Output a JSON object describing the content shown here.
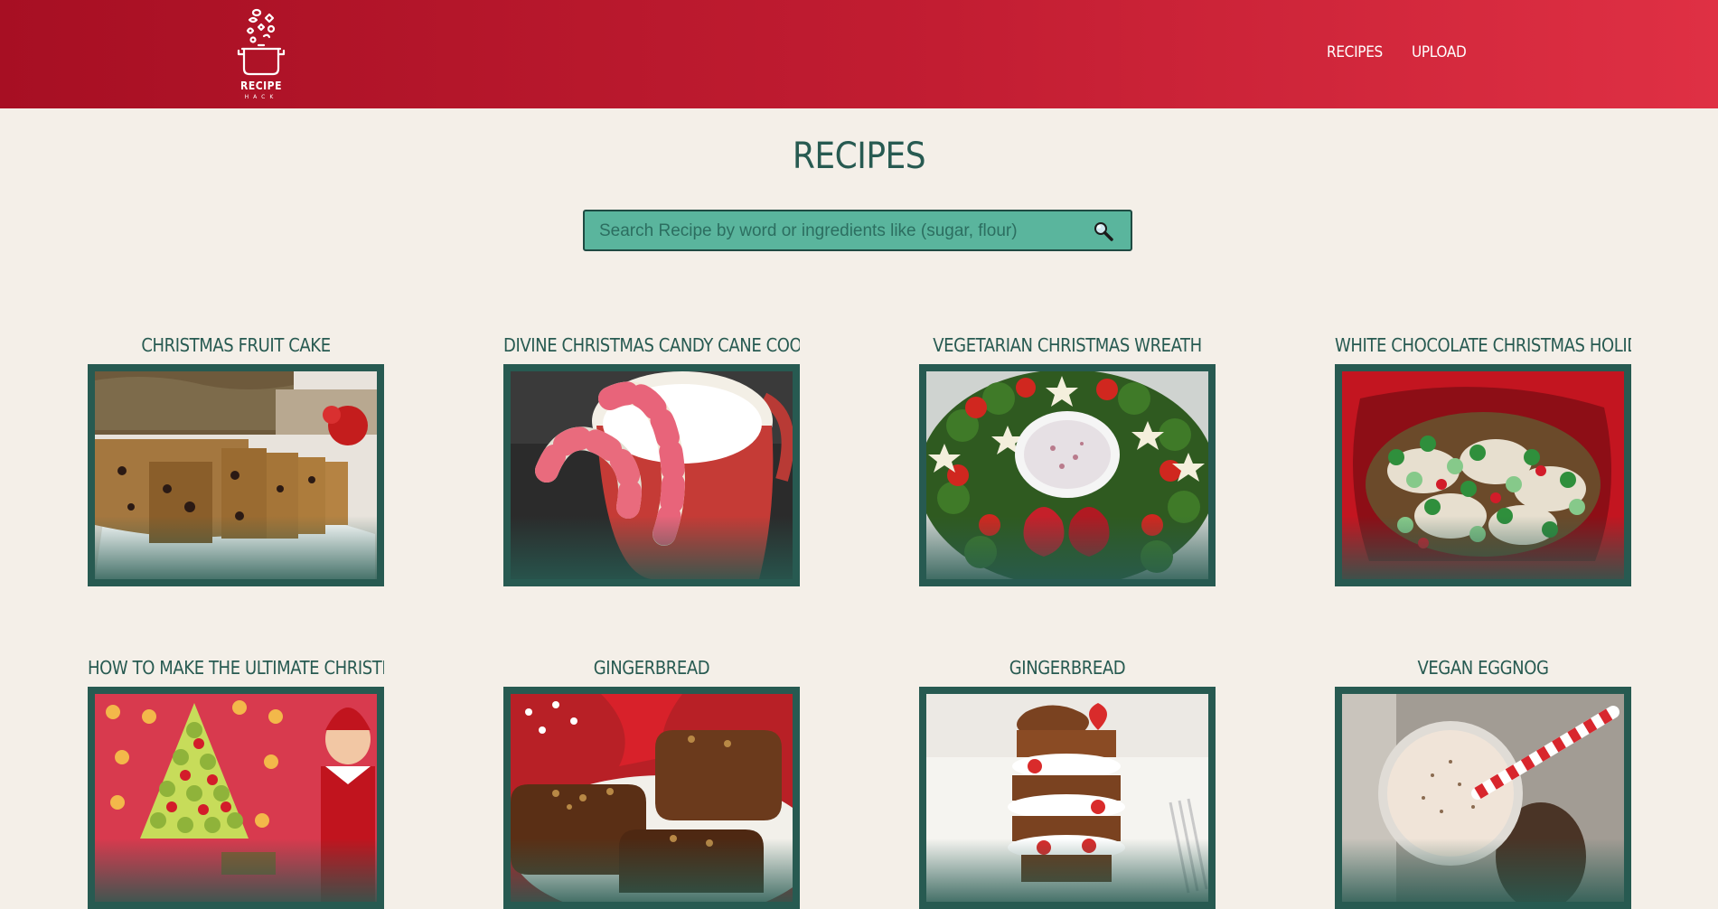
{
  "header": {
    "logo": {
      "icon": "cooking-pot-icon",
      "title": "RECIPE",
      "subtitle": "HACK"
    },
    "nav": [
      {
        "label": "RECIPES"
      },
      {
        "label": "UPLOAD"
      }
    ],
    "colors": {
      "gradient_start": "#a70f23",
      "gradient_end": "#df3044"
    }
  },
  "main": {
    "title": "RECIPES",
    "search": {
      "placeholder": "Search Recipe by word or ingredients like (sugar, flour)",
      "value": "",
      "icon": "magnifier-icon"
    }
  },
  "recipes": [
    {
      "title": "CHRISTMAS FRUIT CAKE",
      "image": "fruit-cake-photo"
    },
    {
      "title": "DIVINE CHRISTMAS CANDY CANE COOK...",
      "image": "candy-cane-cookies-photo"
    },
    {
      "title": "VEGETARIAN CHRISTMAS WREATH",
      "image": "veggie-wreath-photo"
    },
    {
      "title": "WHITE CHOCOLATE CHRISTMAS HOLID...",
      "image": "white-chocolate-pretzels-photo"
    },
    {
      "title": "HOW TO MAKE THE ULTIMATE CHRISTM...",
      "image": "fruit-tree-platter-photo"
    },
    {
      "title": "GINGERBREAD",
      "image": "gingerbread-loaves-photo"
    },
    {
      "title": "GINGERBREAD",
      "image": "gingerbread-stack-photo"
    },
    {
      "title": "VEGAN EGGNOG",
      "image": "eggnog-glass-photo"
    }
  ],
  "colors": {
    "background": "#f4efe8",
    "accent": "#275a51",
    "search_bg": "#5ab59d"
  }
}
